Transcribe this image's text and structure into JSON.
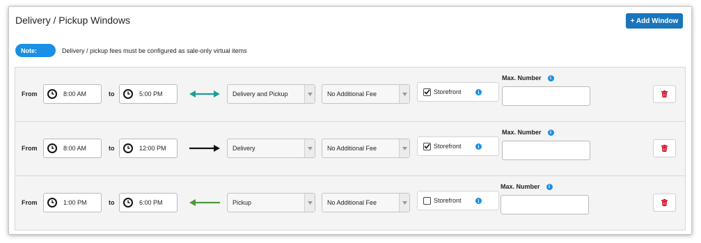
{
  "header": {
    "title": "Delivery / Pickup Windows",
    "add_button_label": "+ Add Window"
  },
  "note": {
    "badge": "Note:",
    "text": "Delivery / pickup fees must be configured as sale-only virtual items"
  },
  "labels": {
    "from": "From",
    "to": "to",
    "max_number": "Max. Number",
    "storefront": "Storefront",
    "info_glyph": "i"
  },
  "colors": {
    "accent": "#1a75bb",
    "info": "#1a8fe3",
    "arrow_both": "#1a9e9a",
    "arrow_delivery": "#111111",
    "arrow_pickup": "#4a9a3a",
    "delete": "#d0021b"
  },
  "windows": [
    {
      "from_time": "8:00 AM",
      "to_time": "5:00 PM",
      "direction_icon": "double-arrow-icon",
      "type": "Delivery and Pickup",
      "fee": "No Additional Fee",
      "storefront_checked": true,
      "max_number": ""
    },
    {
      "from_time": "8:00 AM",
      "to_time": "12:00 PM",
      "direction_icon": "right-arrow-icon",
      "type": "Delivery",
      "fee": "No Additional Fee",
      "storefront_checked": true,
      "max_number": ""
    },
    {
      "from_time": "1:00 PM",
      "to_time": "6:00 PM",
      "direction_icon": "left-arrow-icon",
      "type": "Pickup",
      "fee": "No Additional Fee",
      "storefront_checked": false,
      "max_number": ""
    }
  ]
}
